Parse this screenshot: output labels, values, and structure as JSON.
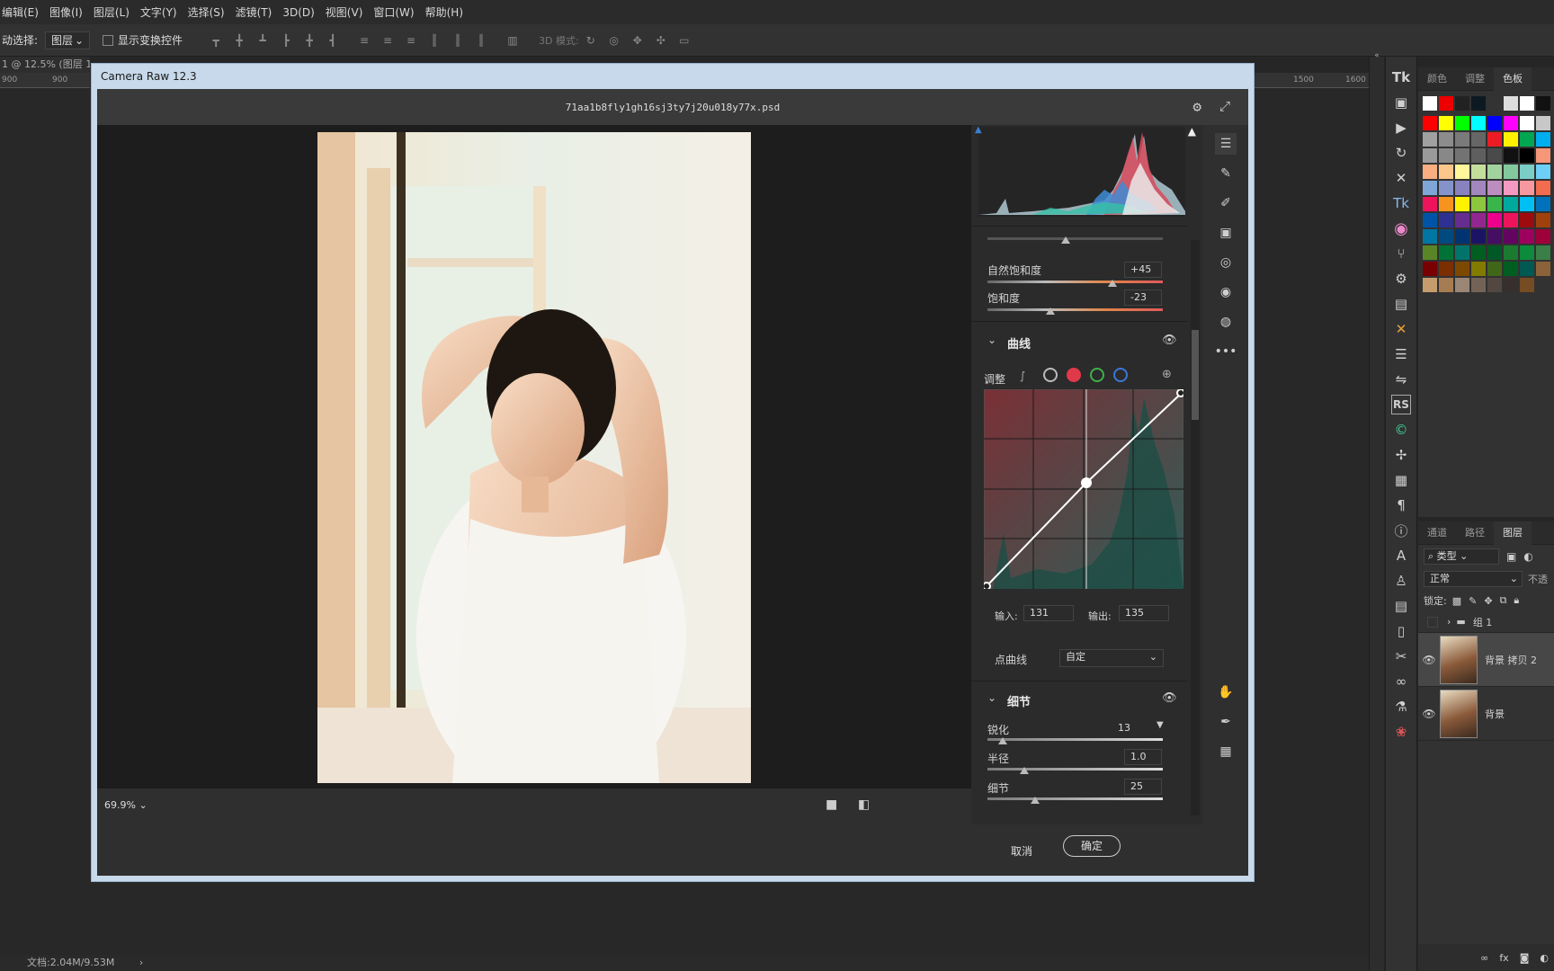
{
  "menu": [
    "编辑(E)",
    "图像(I)",
    "图层(L)",
    "文字(Y)",
    "选择(S)",
    "滤镜(T)",
    "3D(D)",
    "视图(V)",
    "窗口(W)",
    "帮助(H)"
  ],
  "options": {
    "auto_select_label": "动选择:",
    "auto_select_value": "图层",
    "show_transform": "显示变换控件",
    "mode_3d": "3D 模式:"
  },
  "doc_tab": "1 @ 12.5% (图层 1,",
  "ruler": {
    "left": [
      "900",
      "900"
    ],
    "right": [
      "1500",
      "1600"
    ]
  },
  "status": "文档:2.04M/9.53M",
  "dialog": {
    "title": "Camera Raw 12.3",
    "filename": "71aa1b8fly1gh16sj3ty7j20u018y77x.psd",
    "zoom": "69.9%",
    "cancel": "取消",
    "ok": "确定"
  },
  "basic": {
    "vibrance_label": "自然饱和度",
    "vibrance": "+45",
    "saturation_label": "饱和度",
    "saturation": "-23"
  },
  "curve": {
    "section": "曲线",
    "adjust_label": "调整",
    "input_label": "输入:",
    "input": "131",
    "output_label": "输出:",
    "output": "135",
    "point_curve_label": "点曲线",
    "point_curve": "自定"
  },
  "detail": {
    "section": "细节",
    "sharpen_label": "锐化",
    "sharpen": "13",
    "radius_label": "半径",
    "radius": "1.0",
    "detail_label": "细节",
    "detail": "25"
  },
  "swatch_tabs": [
    "颜色",
    "调整",
    "色板"
  ],
  "swatches": [
    "#ff0000",
    "#ffff00",
    "#00ff00",
    "#00ffff",
    "#0000ff",
    "#ff00ff",
    "#ffffff",
    "#c8c8c8",
    "#a0a0a0",
    "#8c8c8c",
    "#7a7a7a",
    "#666666",
    "#ed1c24",
    "#fff200",
    "#00a651",
    "#00aeef",
    "#9a9a9a",
    "#888888",
    "#737373",
    "#5f5f5f",
    "#4a4a4a",
    "#111111",
    "#000000",
    "#f7977a",
    "#f9ad81",
    "#fdc68a",
    "#fff79a",
    "#c4df9b",
    "#a2d39c",
    "#82ca9d",
    "#7bcdc8",
    "#6ecff6",
    "#7ea7d8",
    "#8493ca",
    "#8882be",
    "#a187be",
    "#bc8dbf",
    "#f49ac2",
    "#f6989d",
    "#f26c4f",
    "#ed145b",
    "#f7941d",
    "#fff200",
    "#8dc63f",
    "#39b54a",
    "#00a99d",
    "#00bff3",
    "#0072bc",
    "#0054a6",
    "#2e3192",
    "#662d91",
    "#92278f",
    "#ec008c",
    "#ed145b",
    "#9e0b0f",
    "#a0410d",
    "#0076a3",
    "#004a80",
    "#003471",
    "#1b1464",
    "#440e62",
    "#630460",
    "#9e005d",
    "#9e0039",
    "#598527",
    "#007236",
    "#00746b",
    "#005e20",
    "#005826",
    "#1a7b30",
    "#0d8a3c",
    "#3a7f47",
    "#790000",
    "#7b2e00",
    "#7d4900",
    "#827b00",
    "#406618",
    "#005e20",
    "#005952",
    "#8c6239",
    "#c69c6d",
    "#a67c52",
    "#998675",
    "#736357",
    "#534741",
    "#362f2d",
    "#754c24"
  ],
  "layer_tabs": [
    "通道",
    "路径",
    "图层"
  ],
  "layers": {
    "filter": "类型",
    "blend": "正常",
    "opacity_label": "不透",
    "lock_label": "锁定:",
    "group": "组 1",
    "layer1": "背景 拷贝 2",
    "layer2": "背景"
  }
}
